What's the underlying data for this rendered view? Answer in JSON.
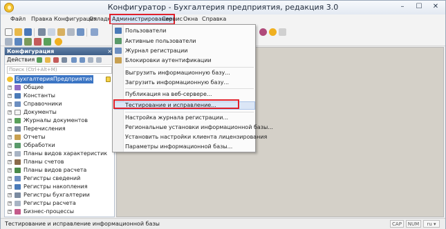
{
  "window": {
    "title": "Конфигуратор - Бухгалтерия предприятия, редакция 3.0",
    "minimize": "–",
    "maximize": "☐",
    "close": "✕"
  },
  "menu": {
    "items": [
      {
        "label": "Файл"
      },
      {
        "label": "Правка"
      },
      {
        "label": "Конфигурация"
      },
      {
        "label": "Отладка"
      },
      {
        "label": "Администрирование"
      },
      {
        "label": "Сервис"
      },
      {
        "label": "Окна"
      },
      {
        "label": "Справка"
      }
    ]
  },
  "admin_menu": {
    "items": [
      {
        "label": "Пользователи",
        "icon": "users-icon"
      },
      {
        "label": "Активные пользователи",
        "icon": "active-users-icon"
      },
      {
        "label": "Журнал регистрации",
        "icon": "journal-icon"
      },
      {
        "label": "Блокировки аутентификации",
        "icon": "lock-icon"
      },
      {
        "label": "Выгрузить информационную базу..."
      },
      {
        "label": "Загрузить информационную базу..."
      },
      {
        "label": "Публикация на веб-сервере..."
      },
      {
        "label": "Тестирование и исправление..."
      },
      {
        "label": "Настройка журнала регистрации..."
      },
      {
        "label": "Региональные установки информационной базы..."
      },
      {
        "label": "Установить настройки клиента лицензирования"
      },
      {
        "label": "Параметры информационной базы..."
      }
    ],
    "selected_index": 7
  },
  "config_panel": {
    "title": "Конфигурация",
    "close": "×",
    "actions_label": "Действия",
    "search_placeholder": "Поиск (Ctrl+Alt+M)",
    "root": "БухгалтерияПредприятия",
    "items": [
      {
        "label": "Общие",
        "icon": "common-icon"
      },
      {
        "label": "Константы",
        "icon": "constants-icon"
      },
      {
        "label": "Справочники",
        "icon": "catalogs-icon"
      },
      {
        "label": "Документы",
        "icon": "documents-icon"
      },
      {
        "label": "Журналы документов",
        "icon": "doc-journals-icon"
      },
      {
        "label": "Перечисления",
        "icon": "enums-icon"
      },
      {
        "label": "Отчеты",
        "icon": "reports-icon"
      },
      {
        "label": "Обработки",
        "icon": "processing-icon"
      },
      {
        "label": "Планы видов характеристик",
        "icon": "char-types-icon"
      },
      {
        "label": "Планы счетов",
        "icon": "charts-of-accounts-icon"
      },
      {
        "label": "Планы видов расчета",
        "icon": "calc-types-icon"
      },
      {
        "label": "Регистры сведений",
        "icon": "info-registers-icon"
      },
      {
        "label": "Регистры накопления",
        "icon": "accum-registers-icon"
      },
      {
        "label": "Регистры бухгалтерии",
        "icon": "accounting-registers-icon"
      },
      {
        "label": "Регистры расчета",
        "icon": "calc-registers-icon"
      },
      {
        "label": "Бизнес-процессы",
        "icon": "business-processes-icon"
      }
    ]
  },
  "status": {
    "text": "Тестирование и исправление информационной базы",
    "cap": "CAP",
    "num": "NUM",
    "lang": "ru ▾"
  },
  "colors": {
    "highlight_red": "#e0202a",
    "selection_blue": "#3b75c4",
    "panel_header": "#4a6a94"
  }
}
